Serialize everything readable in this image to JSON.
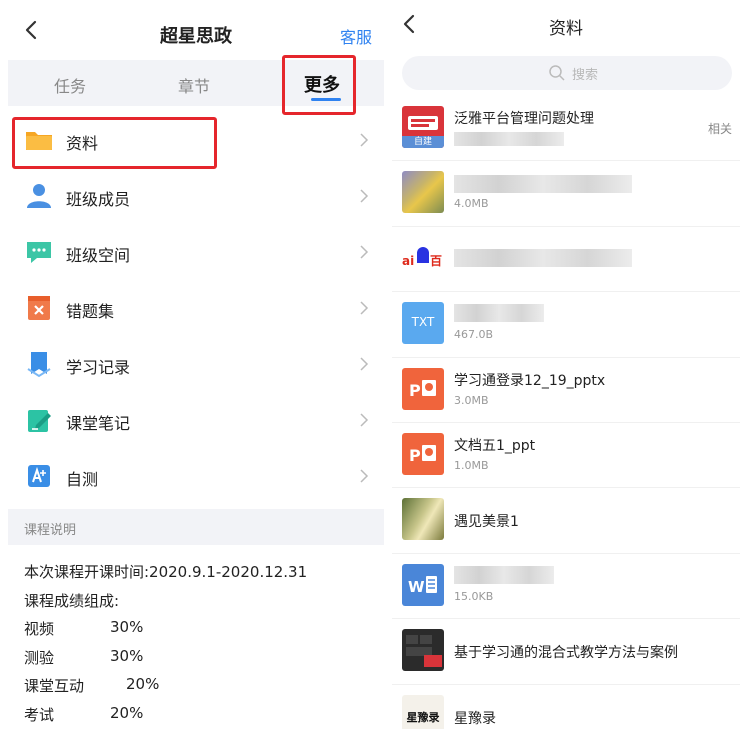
{
  "left": {
    "title": "超星思政",
    "service": "客服",
    "tabs": [
      "任务",
      "章节",
      "更多"
    ],
    "menu": [
      {
        "label": "资料",
        "icon": "folder-icon"
      },
      {
        "label": "班级成员",
        "icon": "person-icon"
      },
      {
        "label": "班级空间",
        "icon": "chat-bubble-icon"
      },
      {
        "label": "错题集",
        "icon": "wrong-set-icon"
      },
      {
        "label": "学习记录",
        "icon": "bookmark-icon"
      },
      {
        "label": "课堂笔记",
        "icon": "note-icon"
      },
      {
        "label": "自测",
        "icon": "self-test-icon"
      }
    ],
    "section_title": "课程说明",
    "description": {
      "line1": "本次课程开课时间:2020.9.1-2020.12.31",
      "line2": "课程成绩组成:",
      "grades": [
        {
          "name": "视频",
          "pct": "30%"
        },
        {
          "name": "测验",
          "pct": "30%"
        },
        {
          "name": "课堂互动",
          "pct": "20%"
        },
        {
          "name": "考试",
          "pct": "20%"
        }
      ]
    },
    "colors": {
      "accent": "#2f82f0",
      "highlight": "#e5262c"
    }
  },
  "right": {
    "title": "资料",
    "search_placeholder": "搜索",
    "files": [
      {
        "name": "泛雅平台管理问题处理",
        "size": "",
        "badge": "自建",
        "related": "相关",
        "thumb": "hello-image"
      },
      {
        "name": "",
        "size": "4.0MB",
        "thumb": "flower-photo"
      },
      {
        "name": "",
        "size": "",
        "thumb": "baidu-logo"
      },
      {
        "name": "",
        "size": "467.0B",
        "thumb": "txt-file-icon",
        "thumb_text": "TXT"
      },
      {
        "name": "学习通登录12_19_pptx",
        "size": "3.0MB",
        "thumb": "ppt-file-icon"
      },
      {
        "name": "文档五1_ppt",
        "size": "1.0MB",
        "thumb": "ppt-file-icon"
      },
      {
        "name": "遇见美景1",
        "size": "",
        "thumb": "scenery-photo"
      },
      {
        "name": "",
        "size": "15.0KB",
        "thumb": "word-file-icon"
      },
      {
        "name": "基于学习通的混合式教学方法与案例",
        "size": "",
        "thumb": "keyboard-photo"
      },
      {
        "name": "星豫录",
        "size": "",
        "thumb": "calligraphy-image",
        "thumb_text": "星豫录"
      }
    ]
  }
}
